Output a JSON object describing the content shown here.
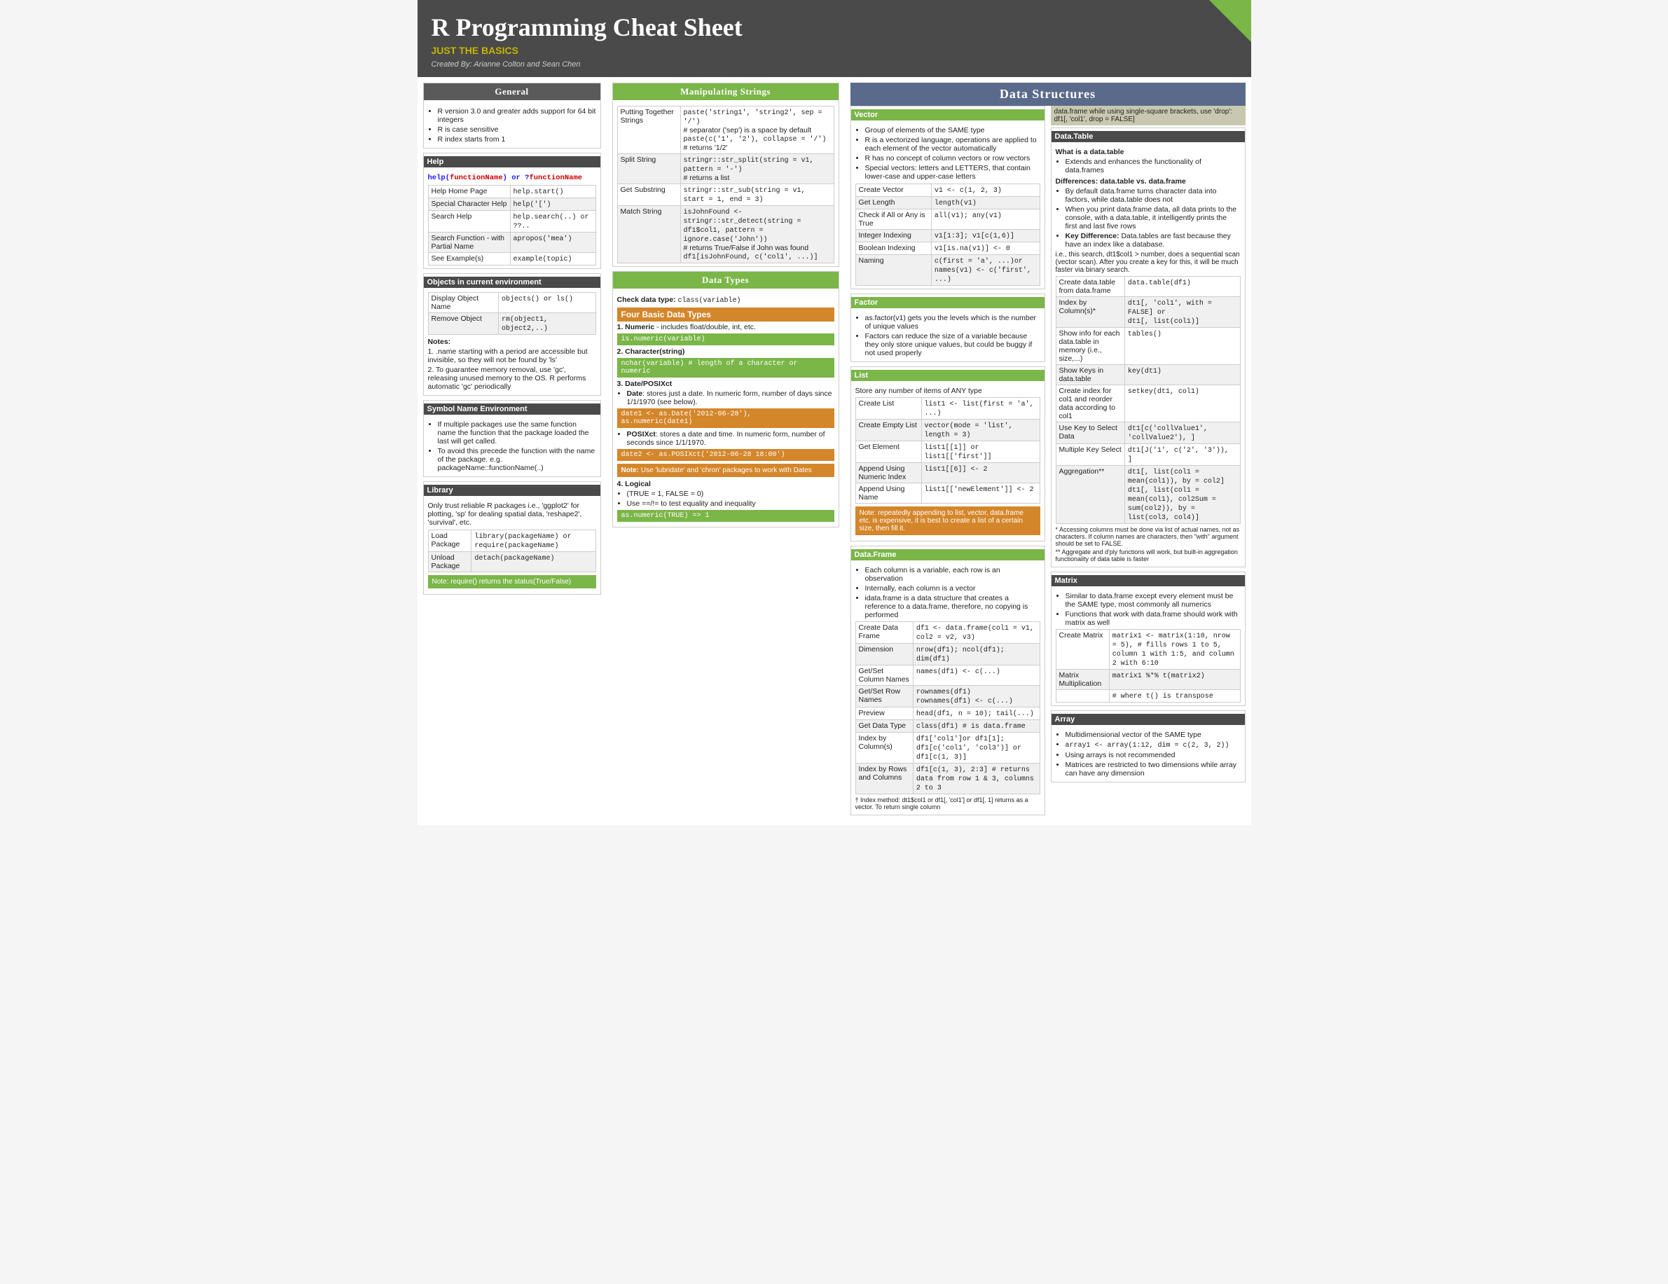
{
  "header": {
    "title": "R Programming Cheat Sheet",
    "subtitle": "Just the Basics",
    "author": "Created By: Arianne Colton and Sean Chen"
  },
  "general": {
    "title": "General",
    "bullets": [
      "R version 3.0 and greater adds support for 64 bit integers",
      "R is case sensitive",
      "R index starts from 1"
    ],
    "help_title": "Help",
    "help_command": "help(functionName) or ?functionName",
    "help_table": [
      [
        "Help Home Page",
        "help.start()"
      ],
      [
        "Special Character Help",
        "help('[')"
      ],
      [
        "Search Help",
        "help.search(..) or ??.."
      ],
      [
        "Search Function - with Partial Name",
        "apropos('mea')"
      ],
      [
        "See Example(s)",
        "example(topic)"
      ]
    ],
    "objects_title": "Objects in current environment",
    "objects_table": [
      [
        "Display Object Name",
        "objects() or ls()"
      ],
      [
        "Remove Object",
        "rm(object1, object2,..)"
      ]
    ],
    "notes_title": "Notes:",
    "notes": [
      "1. .name starting with a period are accessible but invisible, so they will not be found by 'ls'",
      "2. To guarantee memory removal, use 'gc', releasing unused memory to the OS. R performs automatic 'gc' periodically"
    ],
    "symbol_title": "Symbol Name Environment",
    "symbol_bullets": [
      "If multiple packages use the same function name the function that the package loaded the last will get called.",
      "To avoid this precede the function with the name of the package. e.g. packageName::functionName(..)"
    ],
    "library_title": "Library",
    "library_desc": "Only trust reliable R packages i.e., 'ggplot2' for plotting, 'sp' for dealing spatial data, 'reshape2', 'survival', etc.",
    "library_table": [
      [
        "Load Package",
        "library(packageName) or require(packageName)"
      ],
      [
        "Unload Package",
        "detach(packageName)"
      ]
    ],
    "library_note": "Note: require() returns the status(True/False)"
  },
  "manipulating_strings": {
    "title": "Manipulating Strings",
    "rows": [
      {
        "label": "Putting Together Strings",
        "code": "paste('string1', 'string2', sep = '/')\n# separator ('sep') is a space by default\npaste(c('1', '2'), collapse = '/')\n# returns '1/2'"
      },
      {
        "label": "Split String",
        "code": "stringr::str_split(string = v1, pattern = '-')\n# returns a list"
      },
      {
        "label": "Get Substring",
        "code": "stringr::str_sub(string = v1, start = 1, end = 3)"
      },
      {
        "label": "Match String",
        "code": "isJohnFound <- stringr::str_detect(string = df1$col1, pattern = ignore.case('John'))\n# returns True/False if John was found\ndf1[isJohnFound, c('col1', ...)]"
      }
    ]
  },
  "data_types": {
    "title": "Data Types",
    "check_cmd": "Check data type: class(variable)",
    "four_basic_header": "Four Basic Data Types",
    "types": [
      {
        "num": "1.",
        "name": "Numeric",
        "desc": "- includes float/double, int, etc.",
        "cmd": "is.numeric(variable)"
      },
      {
        "num": "2.",
        "name": "Character(string)",
        "desc": "",
        "cmd": "nchar(variable) # length of a character or numeric"
      },
      {
        "num": "3.",
        "name": "Date/POSIXct",
        "date_desc": "Date: stores just a date. In numeric form, number of days since 1/1/1970 (see below).",
        "date_cmd": "date1 <- as.Date('2012-06-28'),\nas.numeric(date1)",
        "posix_desc": "POSIXct: stores a date and time. In numeric form, number of seconds since 1/1/1970.",
        "posix_cmd": "date2 <- as.POSIXct('2012-06-28 18:00')",
        "note": "Note: Use 'lubridate' and 'chron' packages to work with Dates"
      },
      {
        "num": "4.",
        "name": "Logical",
        "items": [
          "(TRUE = 1, FALSE = 0)",
          "Use ==/!= to test equality and inequality"
        ],
        "cmd": "as.numeric(TRUE) => 1"
      }
    ]
  },
  "vector": {
    "title": "Vector",
    "bullets": [
      "Group of elements of the SAME type",
      "R is a vectorized language, operations are applied to each element of the vector automatically",
      "R has no concept of column vectors or row vectors",
      "Special vectors: letters and LETTERS, that contain lower-case and upper-case letters"
    ],
    "table": [
      [
        "Create Vector",
        "v1 <- c(1, 2, 3)"
      ],
      [
        "Get Length",
        "length(v1)"
      ],
      [
        "Check if All or Any is True",
        "all(v1); any(v1)"
      ],
      [
        "Integer Indexing",
        "v1[1:3]; v1[c(1,6)]"
      ],
      [
        "Boolean Indexing",
        "v1[is.na(v1)] <- 0"
      ],
      [
        "Naming",
        "c(first = 'a', ...)or\nnames(v1) <- c('first', ...)"
      ]
    ]
  },
  "factor": {
    "title": "Factor",
    "bullets": [
      "as.factor(v1) gets you the levels which is the number of unique values",
      "Factors can reduce the size of a variable because they only store unique values, but could be buggy if not used properly"
    ]
  },
  "list": {
    "title": "List",
    "desc": "Store any number of items of ANY type",
    "table": [
      [
        "Create List",
        "list1 <- list(first = 'a', ...)"
      ],
      [
        "Create Empty List",
        "vector(mode = 'list', length = 3)"
      ],
      [
        "Get Element",
        "list1[[1]] or list1[['first']]"
      ],
      [
        "Append Using Numeric Index",
        "list1[[6]] <- 2"
      ],
      [
        "Append Using Name",
        "list1[['newElement']] <- 2"
      ]
    ],
    "note": "Note: repeatedly appending to list, vector, data.frame etc. is expensive, it is best to create a list of a certain size, then fill it."
  },
  "data_frame": {
    "title": "Data.Frame",
    "bullets": [
      "Each column is a variable, each row is an observation",
      "Internally, each column is a vector",
      "idata.frame is a data structure that creates a reference to a data.frame, therefore, no copying is performed"
    ],
    "table": [
      [
        "Create Data Frame",
        "df1 <- data.frame(col1 = v1, col2 = v2, v3)"
      ],
      [
        "Dimension",
        "nrow(df1); ncol(df1); dim(df1)"
      ],
      [
        "Get/Set Column Names",
        "names(df1) <- c(...)"
      ],
      [
        "Get/Set Row Names",
        "rownames(df1)\nrownames(df1) <- c(...)"
      ],
      [
        "Preview",
        "head(df1, n = 10); tail(...)"
      ],
      [
        "Get Data Type",
        "class(df1) # is data.frame"
      ],
      [
        "Index by Column(s)",
        "df1['col1']or df1[1];\ndf1[c('col1', 'col3')] or\ndf1[c(1, 3)]"
      ],
      [
        "Index by Rows and Columns",
        "df1[c(1, 3), 2:3] # returns data from row 1 & 3, columns 2 to 3"
      ]
    ],
    "footer_note": "† Index method: dt1$col1 or df1[, 'col1'] or df1[, 1] returns as a vector. To return single column"
  },
  "data_structures": {
    "title": "Data Structures",
    "top_note": "data.frame while using single-square brackets, use 'drop': df1[, 'col1', drop = FALSE]",
    "datatable_title": "Data.Table",
    "what_is": "What is a data.table",
    "what_desc": "Extends and enhances the functionality of data.frames",
    "diff_title": "Differences: data.table vs. data.frame",
    "diff_bullets": [
      "By default data.frame turns character data into factors, while data.table does not",
      "When you print data.frame data, all data prints to the console, with a data.table, it intelligently prints the first and last five rows",
      "Key Difference: Data.tables are fast because they have an index like a database."
    ],
    "diff_note": "i.e., this search, dt1$col1 > number, does a sequential scan (vector scan). After you create a key for this, it will be much faster via binary search.",
    "datatable_table": [
      [
        "Create data.table from data.frame",
        "data.table(df1)"
      ],
      [
        "Index by Column(s)*",
        "dt1[, 'col1', with = FALSE] or\ndt1[, list(col1)]"
      ],
      [
        "Show info for each data.table in memory (i.e., size,...)",
        "tables()"
      ],
      [
        "Show Keys in data.table",
        "key(dt1)"
      ],
      [
        "Create index for col1 and reorder data according to col1",
        "setkey(dt1, col1)"
      ],
      [
        "Use Key to Select Data",
        "dt1[c('collValue1', 'collValue2'), ]"
      ],
      [
        "Multiple Key Select",
        "dt1[J('1', c('2', '3')), ]"
      ],
      [
        "Aggregation**",
        "dt1[, list(col1 = mean(col1)), by = col2]\ndt1[, list(col1 = mean(col1), col2Sum = sum(col2)), by = list(col3, col4)]"
      ]
    ],
    "footnote1": "* Accessing columns must be done via list of actual names, not as characters. If column names are characters, then \"with\" argument should be set to FALSE.",
    "footnote2": "** Aggregate and d'ply functions will work, but built-in aggregation functionality of data table is faster",
    "matrix_title": "Matrix",
    "matrix_bullets": [
      "Similar to data.frame except every element must be the SAME type, most commonly all numerics",
      "Functions that work with data.frame should work with matrix as well"
    ],
    "matrix_table": [
      [
        "Create Matrix",
        "matrix1 <- matrix(1:10, nrow = 5), # fills rows 1 to 5, column 1 with 1:5, and column 2 with 6:10"
      ],
      [
        "Matrix Multiplication",
        "matrix1 %*% t(matrix2)"
      ],
      [
        "",
        "# where t() is transpose"
      ]
    ],
    "array_title": "Array",
    "array_bullets": [
      "Multidimensional vector of the SAME type",
      "array1 <- array(1:12, dim = c(2, 3, 2))",
      "Using arrays is not recommended",
      "Matrices are restricted to two dimensions while array can have any dimension"
    ]
  }
}
